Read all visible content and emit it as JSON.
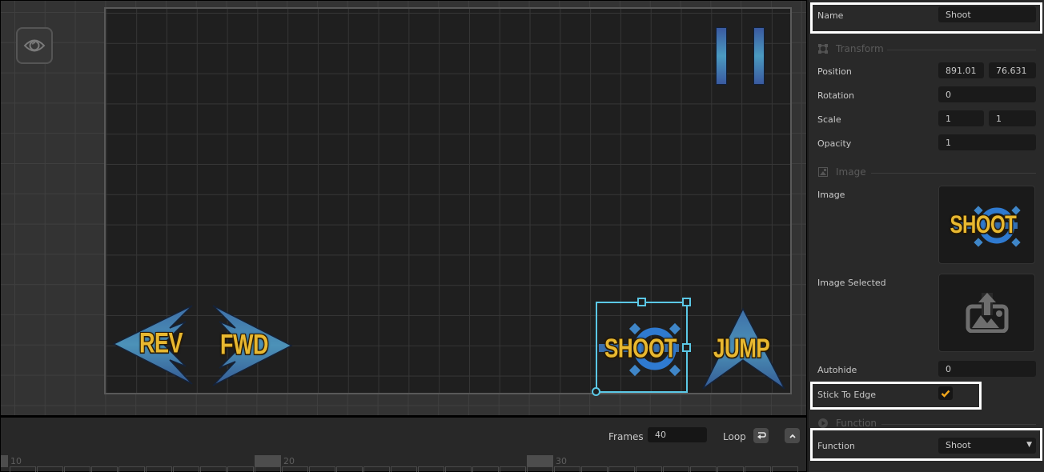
{
  "scene": {
    "visibility_toggle_icon": "eye-icon",
    "sprites": [
      {
        "id": "pause",
        "label": "",
        "icon": "pause-icon"
      },
      {
        "id": "rev",
        "label": "REV",
        "icon": "left-arrow-icon"
      },
      {
        "id": "fwd",
        "label": "FWD",
        "icon": "right-arrow-icon"
      },
      {
        "id": "shoot",
        "label": "SHOOT",
        "icon": "target-icon",
        "selected": true
      },
      {
        "id": "jump",
        "label": "JUMP",
        "icon": "up-arrow-icon"
      }
    ],
    "selection_color": "#5bc8e6"
  },
  "timeline": {
    "frames_label": "Frames",
    "frames_value": "40",
    "loop_label": "Loop",
    "loop_icon": "loop-return-icon",
    "collapse_icon": "chevron-up-icon",
    "ruler_numbers": [
      "10",
      "20",
      "30"
    ]
  },
  "inspector": {
    "name": {
      "label": "Name",
      "value": "Shoot"
    },
    "transform": {
      "title": "Transform",
      "icon": "transform-icon",
      "position": {
        "label": "Position",
        "x": "891.018",
        "y": "76.631"
      },
      "rotation": {
        "label": "Rotation",
        "value": "0"
      },
      "scale": {
        "label": "Scale",
        "x": "1",
        "y": "1"
      },
      "opacity": {
        "label": "Opacity",
        "value": "1"
      }
    },
    "image": {
      "title": "Image",
      "icon": "image-icon",
      "image_label": "Image",
      "image_preview_text": "SHOOT",
      "image_selected_label": "Image Selected",
      "image_selected_icon": "upload-image-icon",
      "autohide": {
        "label": "Autohide",
        "value": "0"
      },
      "stick_to_edge": {
        "label": "Stick To Edge",
        "checked": true
      }
    },
    "function": {
      "title": "Function",
      "icon": "play-circle-icon",
      "label": "Function",
      "value": "Shoot"
    },
    "accent_check_color": "#f2a71b"
  }
}
